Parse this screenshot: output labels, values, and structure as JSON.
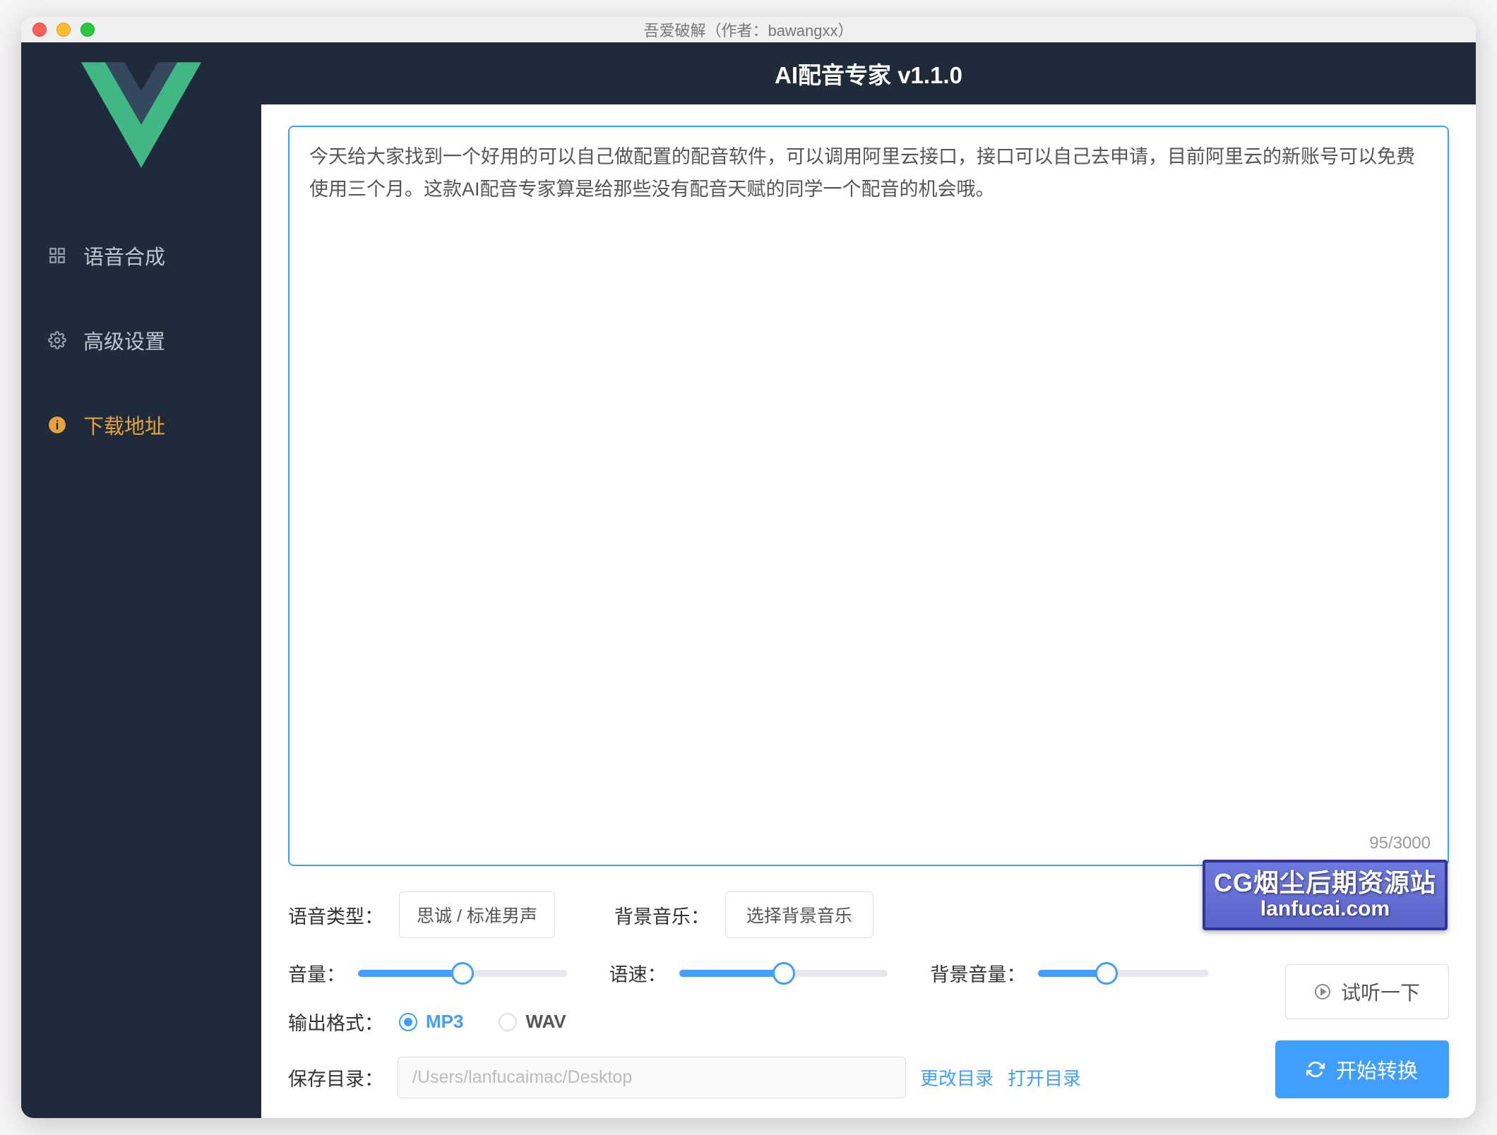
{
  "window": {
    "title": "吾爱破解（作者：bawangxx）"
  },
  "header": {
    "title": "AI配音专家 v1.1.0"
  },
  "sidebar": {
    "items": [
      {
        "label": "语音合成"
      },
      {
        "label": "高级设置"
      },
      {
        "label": "下载地址"
      }
    ]
  },
  "editor": {
    "text": "今天给大家找到一个好用的可以自己做配置的配音软件，可以调用阿里云接口，接口可以自己去申请，目前阿里云的新账号可以免费使用三个月。这款AI配音专家算是给那些没有配音天赋的同学一个配音的机会哦。",
    "count": "95/3000"
  },
  "controls": {
    "voice_type_label": "语音类型：",
    "voice_type_value": "思诚 / 标准男声",
    "bg_music_label": "背景音乐：",
    "bg_music_value": "选择背景音乐",
    "volume_label": "音量：",
    "volume_pct": 50,
    "speed_label": "语速：",
    "speed_pct": 50,
    "bg_volume_label": "背景音量：",
    "bg_volume_pct": 40,
    "format_label": "输出格式：",
    "format_mp3": "MP3",
    "format_wav": "WAV",
    "save_dir_label": "保存目录：",
    "save_dir_value": "/Users/lanfucaimac/Desktop",
    "change_dir": "更改目录",
    "open_dir": "打开目录"
  },
  "actions": {
    "preview": "试听一下",
    "convert": "开始转换"
  },
  "watermark": {
    "line1": "CG烟尘后期资源站",
    "line2": "lanfucai.com"
  }
}
